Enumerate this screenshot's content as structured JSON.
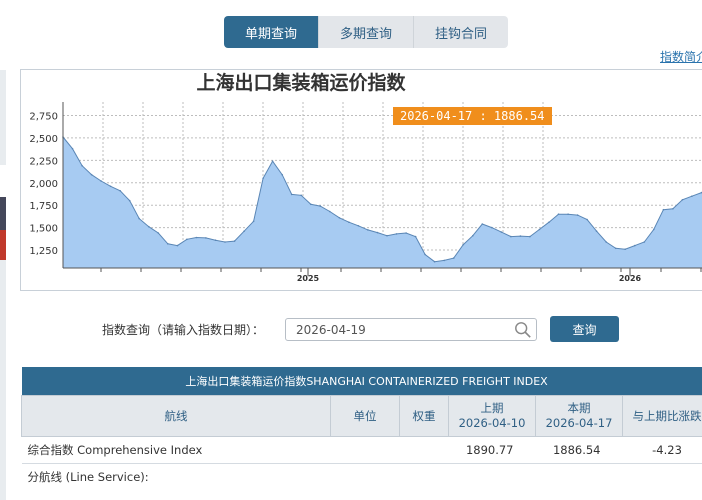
{
  "tabs": [
    {
      "label": "单期查询",
      "active": true
    },
    {
      "label": "多期查询",
      "active": false
    },
    {
      "label": "挂钩合同",
      "active": false
    }
  ],
  "intro_link": "指数简介",
  "chart_data": {
    "type": "area",
    "title": "上海出口集装箱运价指数",
    "tooltip": "2026-04-17 : 1886.54",
    "y_ticks": [
      2750,
      2500,
      2250,
      2000,
      1750,
      1500,
      1250
    ],
    "x_tick_labels": [
      "2025",
      "2026"
    ],
    "ylim": [
      1050,
      2900
    ],
    "values": [
      2510,
      2380,
      2190,
      2090,
      2020,
      1960,
      1910,
      1800,
      1600,
      1510,
      1440,
      1320,
      1300,
      1370,
      1390,
      1385,
      1360,
      1340,
      1350,
      1460,
      1570,
      2050,
      2240,
      2090,
      1870,
      1860,
      1760,
      1740,
      1680,
      1610,
      1560,
      1520,
      1475,
      1445,
      1410,
      1430,
      1440,
      1400,
      1200,
      1120,
      1135,
      1160,
      1310,
      1410,
      1540,
      1500,
      1450,
      1400,
      1405,
      1400,
      1480,
      1560,
      1650,
      1650,
      1640,
      1590,
      1460,
      1340,
      1270,
      1260,
      1300,
      1340,
      1480,
      1700,
      1710,
      1810,
      1850,
      1890,
      1886.54
    ],
    "fill_color": "#a7cbf2",
    "line_color": "#5a86b5",
    "grid": true
  },
  "query": {
    "label": "指数查询（请输入指数日期）：",
    "date_value": "2026-04-19",
    "button": "查询"
  },
  "table": {
    "title": "上海出口集装箱运价指数SHANGHAI CONTAINERIZED FREIGHT INDEX",
    "headers": {
      "route": "航线",
      "unit": "单位",
      "weight": "权重",
      "prev_line1": "上期",
      "prev_line2": "2026-04-10",
      "curr_line1": "本期",
      "curr_line2": "2026-04-17",
      "change": "与上期比涨跌"
    },
    "rows": [
      {
        "route": "综合指数 Comprehensive Index",
        "unit": "",
        "weight": "",
        "prev": "1890.77",
        "curr": "1886.54",
        "change": "-4.23"
      }
    ],
    "subheading": "分航线 (Line Service):"
  },
  "colors": {
    "accent": "#2f6a90",
    "tooltip": "#f08e1c"
  }
}
